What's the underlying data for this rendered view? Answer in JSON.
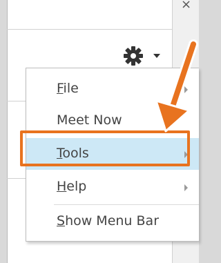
{
  "window": {
    "close_glyph": "×"
  },
  "toolbar": {
    "gear_icon": "gear-icon",
    "caret_icon": "chevron-down-icon"
  },
  "menu": {
    "items": [
      {
        "label": "File",
        "mnemonic": "F",
        "rest": "ile",
        "has_submenu": true
      },
      {
        "label": "Meet Now",
        "has_submenu": false
      },
      {
        "label": "Tools",
        "mnemonic": "T",
        "rest": "ools",
        "has_submenu": true,
        "highlighted": true
      },
      {
        "label": "Help",
        "mnemonic": "H",
        "rest": "elp",
        "has_submenu": true
      },
      {
        "label": "Show Menu Bar",
        "mnemonic": "S",
        "rest": "how Menu Bar",
        "has_submenu": false
      }
    ]
  },
  "annotation": {
    "color": "#e8731f",
    "highlight": "#cde8f6"
  }
}
